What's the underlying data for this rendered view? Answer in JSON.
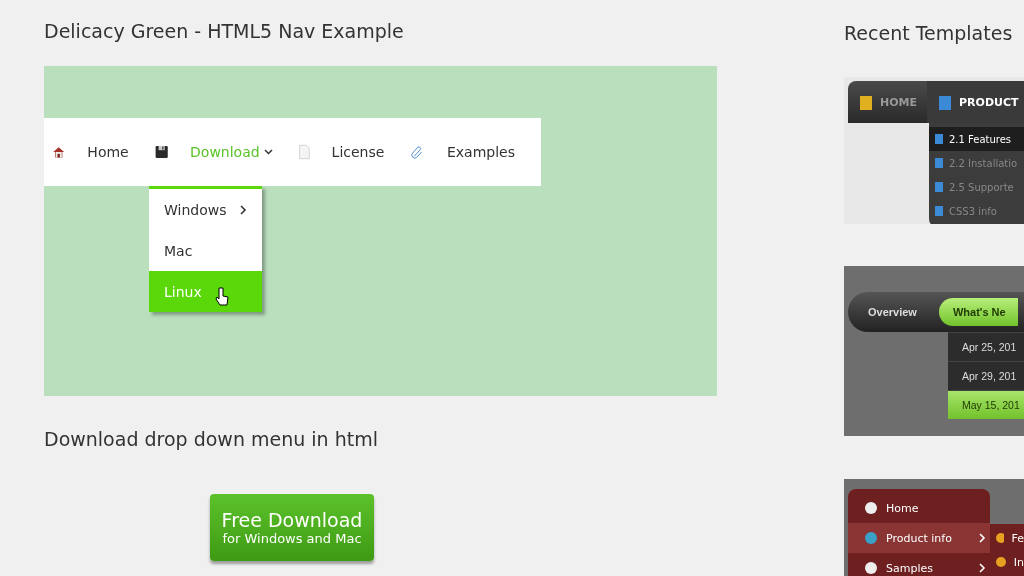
{
  "demo": {
    "title": "Delicacy Green - HTML5 Nav Example",
    "nav": [
      {
        "label": "Home",
        "selected": false,
        "has_dropdown": false
      },
      {
        "label": "Download",
        "selected": true,
        "has_dropdown": true
      },
      {
        "label": "License",
        "selected": false,
        "has_dropdown": false
      },
      {
        "label": "Examples",
        "selected": false,
        "has_dropdown": false
      }
    ],
    "dropdown": [
      {
        "label": "Windows",
        "selected": false,
        "has_submenu": true
      },
      {
        "label": "Mac",
        "selected": false,
        "has_submenu": false
      },
      {
        "label": "Linux",
        "selected": true,
        "has_submenu": false
      }
    ]
  },
  "subheading": "Download drop down menu in html",
  "download_button": {
    "title": "Free Download",
    "subtitle": "for Windows and Mac"
  },
  "sidebar": {
    "title": "Recent Templates",
    "template_1": {
      "nav": [
        {
          "label": "HOME",
          "selected": false
        },
        {
          "label": "PRODUCT",
          "selected": true
        }
      ],
      "submenu": [
        {
          "label": "2.1 Features",
          "selected": true
        },
        {
          "label": "2.2 Installatio",
          "selected": false
        },
        {
          "label": "2.5 Supporte",
          "selected": false
        },
        {
          "label": "CSS3 info",
          "selected": false
        }
      ]
    },
    "template_2": {
      "tabs": [
        {
          "label": "Overview",
          "selected": false
        },
        {
          "label": "What's Ne",
          "selected": true
        }
      ],
      "submenu": [
        {
          "label": "Apr 25, 201",
          "selected": false
        },
        {
          "label": "Apr 29, 201",
          "selected": false
        },
        {
          "label": "May 15, 201",
          "selected": true
        }
      ]
    },
    "template_3": {
      "menu": [
        {
          "label": "Home",
          "selected": false,
          "has_submenu": false
        },
        {
          "label": "Product info",
          "selected": true,
          "has_submenu": true
        },
        {
          "label": "Samples",
          "selected": false,
          "has_submenu": true
        }
      ],
      "submenu": [
        {
          "label": "Fe"
        },
        {
          "label": "In"
        }
      ]
    }
  }
}
